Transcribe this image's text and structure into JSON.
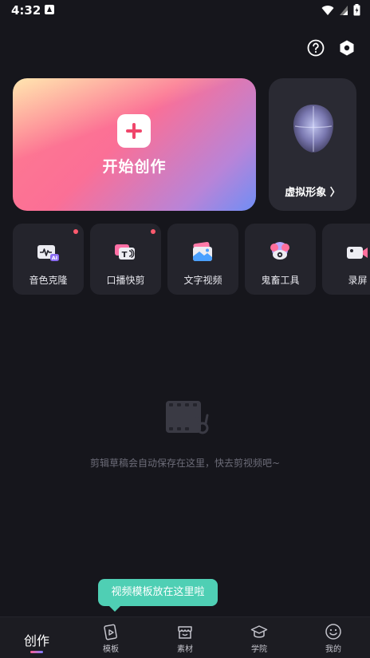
{
  "status_bar": {
    "time": "4:32"
  },
  "start_card": {
    "label": "开始创作"
  },
  "avatar_card": {
    "label": "虚拟形象 〉"
  },
  "tools": [
    {
      "label": "音色克隆",
      "icon": "voice-clone-icon",
      "has_dot": true
    },
    {
      "label": "口播快剪",
      "icon": "talking-cut-icon",
      "has_dot": true
    },
    {
      "label": "文字视频",
      "icon": "text-video-icon",
      "has_dot": false
    },
    {
      "label": "鬼畜工具",
      "icon": "remix-tool-icon",
      "has_dot": false
    },
    {
      "label": "录屏",
      "icon": "screen-record-icon",
      "has_dot": false
    }
  ],
  "empty_state": {
    "text": "剪辑草稿会自动保存在这里，快去剪视频吧~"
  },
  "tooltip": {
    "text": "视频模板放在这里啦"
  },
  "bottom_nav": {
    "items": [
      {
        "label": "创作",
        "active": true
      },
      {
        "label": "模板",
        "active": false
      },
      {
        "label": "素材",
        "active": false
      },
      {
        "label": "学院",
        "active": false
      },
      {
        "label": "我的",
        "active": false
      }
    ]
  },
  "colors": {
    "background": "#16161c",
    "card": "#24242c",
    "accent_pink": "#f0466b",
    "tooltip": "#4fcfb4",
    "dot": "#ff5a6e"
  }
}
